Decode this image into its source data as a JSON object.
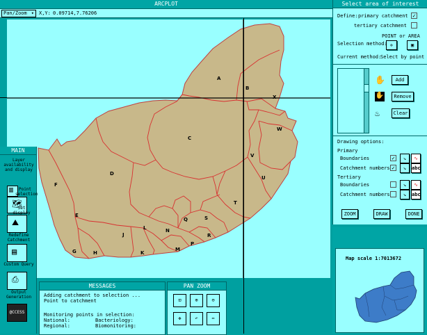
{
  "title": "ARCPLOT",
  "toolbar": {
    "dropdown": "Pan/Zoom",
    "coord_label": "X,Y:",
    "coord_value": "0.09714,7.76206"
  },
  "map": {
    "regions": [
      "A",
      "B",
      "C",
      "D",
      "E",
      "F",
      "G",
      "H",
      "J",
      "K",
      "L",
      "M",
      "N",
      "P",
      "Q",
      "R",
      "S",
      "T",
      "U",
      "V",
      "W",
      "X"
    ],
    "land_color": "#c8b88a",
    "boundary_color": "#e03030",
    "sea_color": "#99ffff"
  },
  "right_panel": {
    "title": "Select area of interest",
    "define_label": "Define:",
    "primary_label": "primary catchment",
    "tertiary_label": "tertiary catchment",
    "point_area_label": "POINT or AREA",
    "selection_method_label": "Selection method:",
    "current_method_label": "Current method:",
    "current_method_value": "Select by point",
    "add": "Add",
    "remove": "Remove",
    "clear": "Clear",
    "drawing_options_label": "Drawing options:",
    "primary_heading": "Primary",
    "tertiary_heading": "Tertiary",
    "boundaries": "Boundaries",
    "catchment_numbers": "Catchment numbers",
    "abc": "abc",
    "zoom": "ZOOM",
    "draw": "DRAW",
    "done": "DONE",
    "map_scale": "Map scale  1:7013672"
  },
  "main_panel": {
    "title": "MAIN",
    "tools": [
      {
        "label": "Layer availability and display"
      },
      {
        "label": "Point selection"
      },
      {
        "label": "Set display"
      },
      {
        "label": "Redefine Catchment"
      },
      {
        "label": "Custom Query"
      },
      {
        "label": "Output Generation"
      },
      {
        "label": "@CCESS"
      }
    ]
  },
  "messages": {
    "title": "MESSAGES",
    "line1": "Adding catchment to selection ...",
    "line2": "Point to catchment",
    "monitoring": "Monitoring points in selection:",
    "national": "National:",
    "bacteriology": "Bacteriology:",
    "regional": "Regional:",
    "biomonitoring": "Biomonitoring:"
  },
  "panzoom": {
    "title": "PAN ZOOM",
    "buttons": [
      "ZOOM WINDOW",
      "ZOOM IN",
      "ZOOM OUT",
      "PAN",
      "PREVIOUS",
      "PAN/ZOOM"
    ]
  }
}
